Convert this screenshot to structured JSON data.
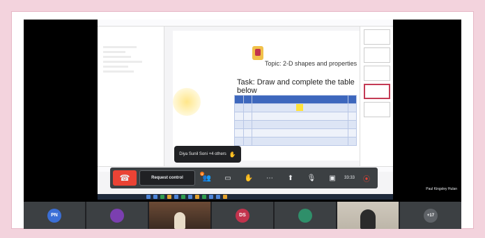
{
  "slide": {
    "topic": "Topic: 2-D shapes and properties",
    "task": "Task: Draw and complete the table below"
  },
  "tooltip": {
    "text": "Diya Sunil Soni +4 others"
  },
  "controls": {
    "request_control_label": "Request control",
    "timer": "33:33",
    "hand_count": "5"
  },
  "presenter_name": "Paul Kingsley Hulan",
  "participants": [
    {
      "initials": "PN",
      "color": "#3b6fd6"
    },
    {
      "initials": "",
      "color": "#3c4043"
    },
    {
      "initials": "",
      "color": "#6b4a35"
    },
    {
      "initials": "DS",
      "color": "#c2334d"
    },
    {
      "initials": "",
      "color": "#3c4043"
    },
    {
      "initials": "",
      "color": "#cfc8bc"
    },
    {
      "initials": "+17",
      "color": "#5f6368"
    }
  ],
  "colors": {
    "accent_red": "#ea4335",
    "bar_bg": "#3c4043",
    "table_header": "#3d67bd",
    "background": "#f3d3dd"
  },
  "icons": [
    "hangup-icon",
    "raise-hand-icon",
    "chat-icon",
    "people-icon",
    "more-icon",
    "present-icon",
    "mic-off-icon",
    "camera-off-icon",
    "record-icon"
  ]
}
